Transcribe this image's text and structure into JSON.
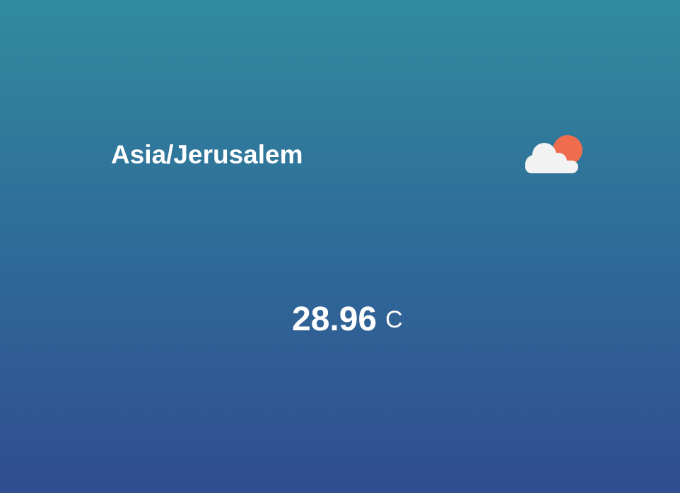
{
  "location": {
    "timezone": "Asia/Jerusalem"
  },
  "condition": {
    "icon": "partly-cloudy-icon",
    "sun_color": "#ef6d4d",
    "cloud_color": "#f2f2f2"
  },
  "temperature": {
    "value": "28.96",
    "unit": "C"
  },
  "colors": {
    "background_top": "#318b9f",
    "background_bottom": "#304d8f",
    "text": "#ffffff"
  }
}
